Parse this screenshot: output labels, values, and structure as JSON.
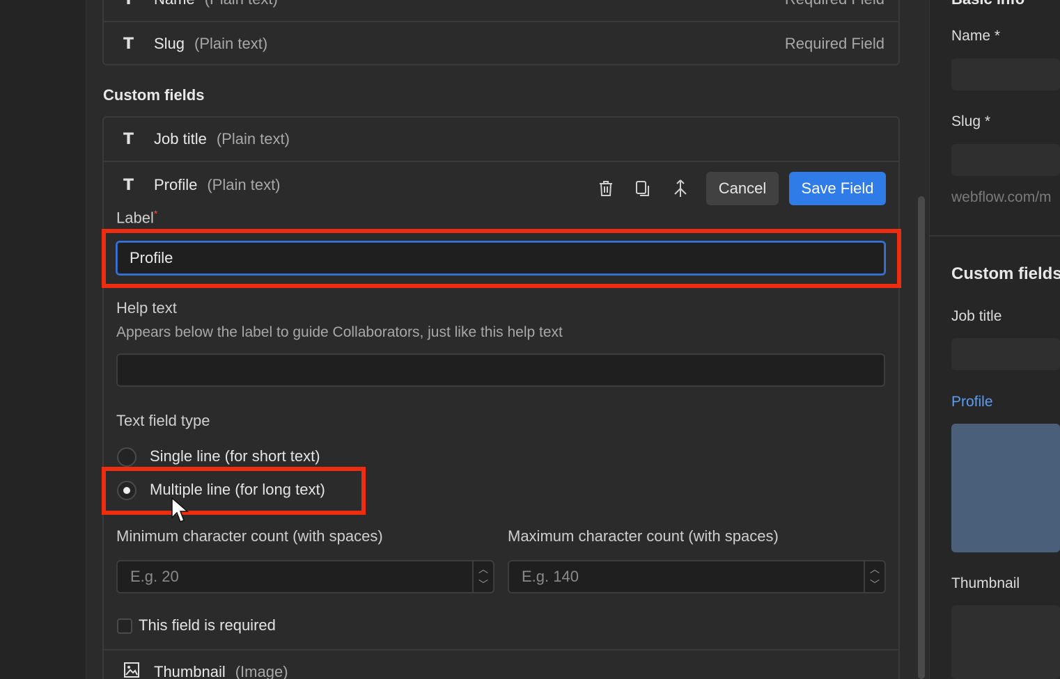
{
  "default_fields": {
    "name": {
      "label": "Name",
      "type": "(Plain text)",
      "requirement": "Required Field"
    },
    "slug": {
      "label": "Slug",
      "type": "(Plain text)",
      "requirement": "Required Field"
    }
  },
  "custom_fields": {
    "section_title": "Custom fields",
    "items": [
      {
        "label": "Job title",
        "type": "(Plain text)"
      },
      {
        "label": "Profile",
        "type": "(Plain text)"
      },
      {
        "label": "Thumbnail",
        "type": "(Image)"
      }
    ]
  },
  "editor": {
    "cancel_label": "Cancel",
    "save_label": "Save Field",
    "label_field": {
      "label": "Label",
      "required_marker": "*",
      "value": "Profile"
    },
    "help_text": {
      "label": "Help text",
      "description": "Appears below the label to guide Collaborators, just like this help text",
      "value": ""
    },
    "text_field_type": {
      "label": "Text field type",
      "options": [
        {
          "label": "Single line (for short text)",
          "selected": false
        },
        {
          "label": "Multiple line (for long text)",
          "selected": true
        }
      ]
    },
    "min_count": {
      "label": "Minimum character count (with spaces)",
      "placeholder": "E.g. 20"
    },
    "max_count": {
      "label": "Maximum character count (with spaces)",
      "placeholder": "E.g. 140"
    },
    "required_checkbox": {
      "label": "This field is required",
      "checked": false
    }
  },
  "preview": {
    "section_basic": "Basic info",
    "name_label": "Name *",
    "slug_label": "Slug *",
    "slug_prefix": "webflow.com/m",
    "custom_title": "Custom fields",
    "job_title": "Job title",
    "profile": "Profile",
    "thumbnail": "Thumbnail"
  },
  "colors": {
    "accent": "#2f7be8",
    "highlight": "#ee2c0f",
    "focus_border": "#3a72d8",
    "profile_preview_fill": "#4a5f7a"
  }
}
